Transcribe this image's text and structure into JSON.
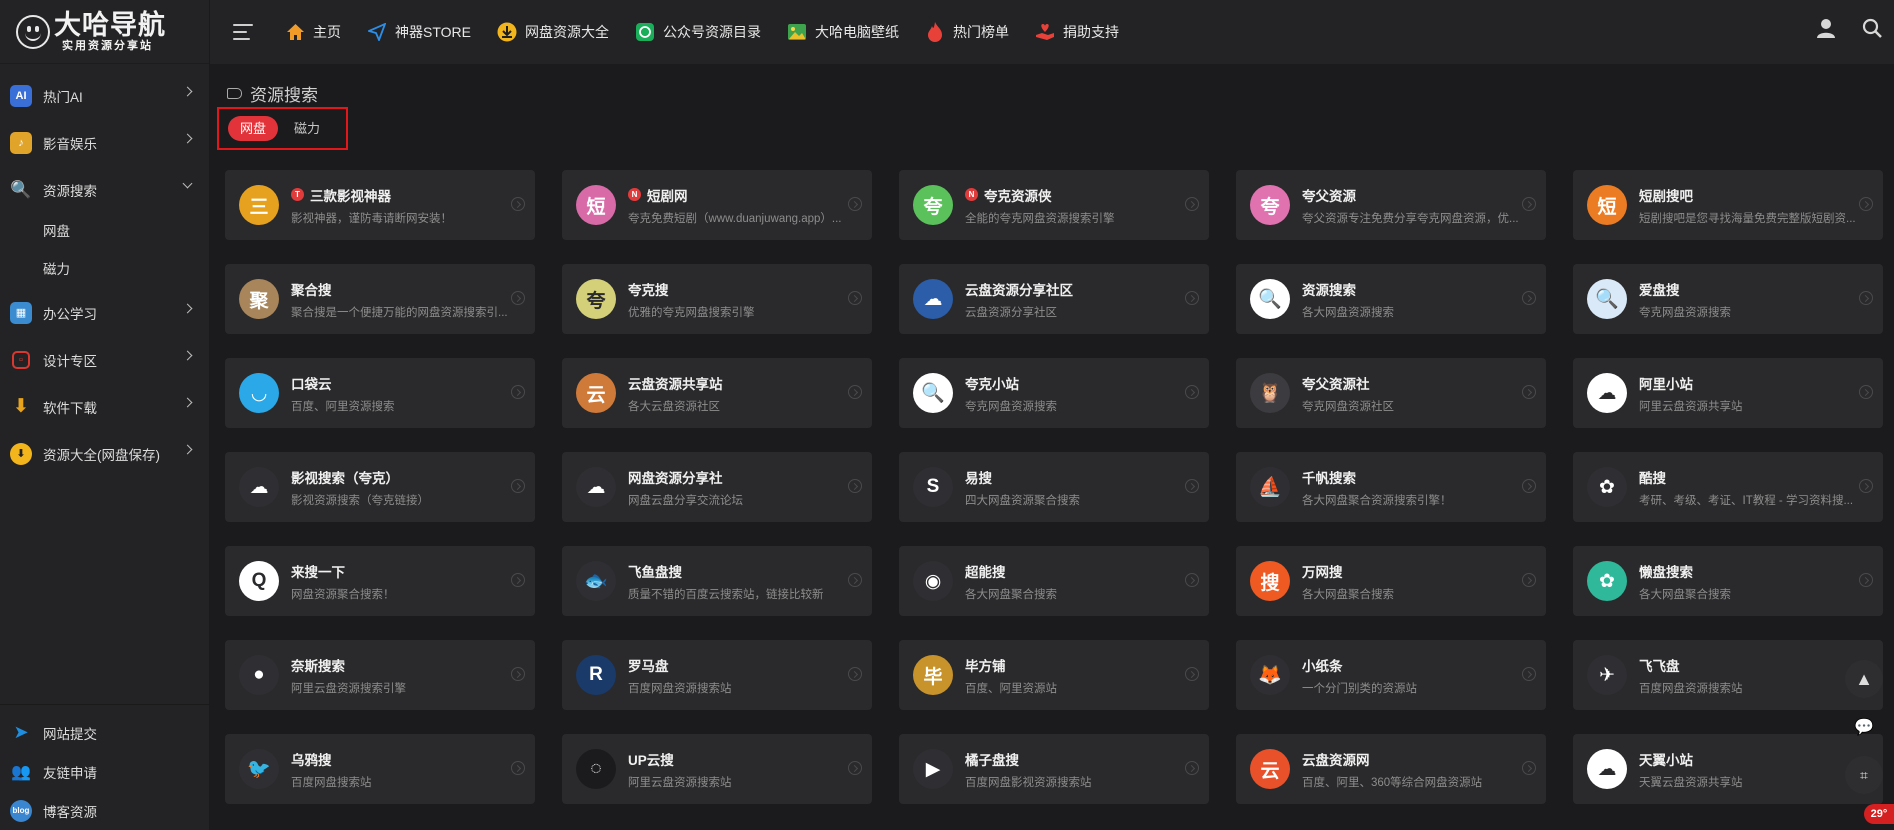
{
  "logo": {
    "title": "大哈导航",
    "subtitle": "实用资源分享站"
  },
  "topnav": [
    {
      "label": "主页",
      "icon": "home-icon"
    },
    {
      "label": "神器STORE",
      "icon": "paper-plane-icon"
    },
    {
      "label": "网盘资源大全",
      "icon": "download-icon"
    },
    {
      "label": "公众号资源目录",
      "icon": "wechat-icon"
    },
    {
      "label": "大哈电脑壁纸",
      "icon": "picture-icon"
    },
    {
      "label": "热门榜单",
      "icon": "fire-icon"
    },
    {
      "label": "捐助支持",
      "icon": "donate-icon"
    }
  ],
  "sidebar": {
    "items": [
      {
        "label": "热门AI",
        "icon": "ai-icon",
        "color": "#3a6fd8"
      },
      {
        "label": "影音娱乐",
        "icon": "media-icon",
        "color": "#e0a42b"
      },
      {
        "label": "资源搜索",
        "icon": "search-icon",
        "color": "#1c9bd6"
      },
      {
        "label": "办公学习",
        "icon": "office-icon",
        "color": "#3a8bd0"
      },
      {
        "label": "设计专区",
        "icon": "calendar-icon",
        "color": "#d8382f"
      },
      {
        "label": "软件下载",
        "icon": "download-icon",
        "color": "#e8a31c"
      },
      {
        "label": "资源大全(网盘保存)",
        "icon": "cloud-download-icon",
        "color": "#f3b51c"
      }
    ],
    "subitems": [
      "网盘",
      "磁力"
    ],
    "bottom": [
      {
        "label": "网站提交",
        "icon": "send-icon",
        "color": "#1e8fe0"
      },
      {
        "label": "友链申请",
        "icon": "users-icon",
        "color": "#3e8fe0"
      },
      {
        "label": "博客资源",
        "icon": "blog-icon",
        "color": "#3a86d0"
      }
    ]
  },
  "section": {
    "title": "资源搜索",
    "tabs": [
      "网盘",
      "磁力"
    ]
  },
  "cards": [
    {
      "name": "三款影视神器",
      "desc": "影视神器，谨防毒请断网安装！",
      "icon": "三",
      "color": "#e6a21f",
      "badge": "T"
    },
    {
      "name": "短剧网",
      "desc": "夸克免费短剧（www.duanjuwang.app）...",
      "icon": "短",
      "color": "#d86aa8",
      "badge": "N"
    },
    {
      "name": "夸克资源侠",
      "desc": "全能的夸克网盘资源搜索引擎",
      "icon": "夸",
      "color": "#5bc25b",
      "badge": "N"
    },
    {
      "name": "夸父资源",
      "desc": "夸父资源专注免费分享夸克网盘资源，优...",
      "icon": "夸",
      "color": "#e072b0"
    },
    {
      "name": "短剧搜吧",
      "desc": "短剧搜吧是您寻找海量免费完整版短剧资...",
      "icon": "短",
      "color": "#ec7c23"
    },
    {
      "name": "聚合搜",
      "desc": "聚合搜是一个便捷万能的网盘资源搜索引...",
      "icon": "聚",
      "color": "#a8855a"
    },
    {
      "name": "夸克搜",
      "desc": "优雅的夸克网盘搜索引擎",
      "icon": "夸",
      "color": "#d4d07a"
    },
    {
      "name": "云盘资源分享社区",
      "desc": "云盘资源分享社区",
      "icon": "☁",
      "color": "#2b5da8"
    },
    {
      "name": "资源搜索",
      "desc": "各大网盘资源搜索",
      "icon": "🔍",
      "color": "#ffffff"
    },
    {
      "name": "爱盘搜",
      "desc": "夸克网盘资源搜索",
      "icon": "🔍",
      "color": "#d9e9f8"
    },
    {
      "name": "口袋云",
      "desc": "百度、阿里资源搜索",
      "icon": "◡",
      "color": "#2aa8e8"
    },
    {
      "name": "云盘资源共享站",
      "desc": "各大云盘资源社区",
      "icon": "云",
      "color": "#d07a3a"
    },
    {
      "name": "夸克小站",
      "desc": "夸克网盘资源搜索",
      "icon": "🔍",
      "color": "#ffffff"
    },
    {
      "name": "夸父资源社",
      "desc": "夸克网盘资源社区",
      "icon": "🦉",
      "color": "#3c3c40"
    },
    {
      "name": "阿里小站",
      "desc": "阿里云盘资源共享站",
      "icon": "☁",
      "color": "#ffffff"
    },
    {
      "name": "影视搜索（夸克）",
      "desc": "影视资源搜索（夸克链接）",
      "icon": "☁",
      "color": "#2f2f33"
    },
    {
      "name": "网盘资源分享社",
      "desc": "网盘云盘分享交流论坛",
      "icon": "☁",
      "color": "#2f2f33"
    },
    {
      "name": "易搜",
      "desc": "四大网盘资源聚合搜索",
      "icon": "S",
      "color": "#2f2f33"
    },
    {
      "name": "千帆搜索",
      "desc": "各大网盘聚合资源搜索引擎！",
      "icon": "⛵",
      "color": "#2f2f33"
    },
    {
      "name": "酷搜",
      "desc": "考研、考级、考证、IT教程 - 学习资料搜...",
      "icon": "✿",
      "color": "#2f2f33"
    },
    {
      "name": "来搜一下",
      "desc": "网盘资源聚合搜索！",
      "icon": "Q",
      "color": "#ffffff"
    },
    {
      "name": "飞鱼盘搜",
      "desc": "质量不错的百度云搜索站，链接比较新",
      "icon": "🐟",
      "color": "#2f2f33"
    },
    {
      "name": "超能搜",
      "desc": "各大网盘聚合搜索",
      "icon": "◉",
      "color": "#2f2f33"
    },
    {
      "name": "万网搜",
      "desc": "各大网盘聚合搜索",
      "icon": "搜",
      "color": "#ee5a22"
    },
    {
      "name": "懒盘搜索",
      "desc": "各大网盘聚合搜索",
      "icon": "✿",
      "color": "#2fb89a"
    },
    {
      "name": "奈斯搜索",
      "desc": "阿里云盘资源搜索引擎",
      "icon": "●",
      "color": "#2f2f33"
    },
    {
      "name": "罗马盘",
      "desc": "百度网盘资源搜索站",
      "icon": "R",
      "color": "#1a3a6a"
    },
    {
      "name": "毕方铺",
      "desc": "百度、阿里资源站",
      "icon": "毕",
      "color": "#c8932a"
    },
    {
      "name": "小纸条",
      "desc": "一个分门别类的资源站",
      "icon": "🦊",
      "color": "#2f2f33"
    },
    {
      "name": "飞飞盘",
      "desc": "百度网盘资源搜索站",
      "icon": "✈",
      "color": "#2f2f33"
    },
    {
      "name": "乌鸦搜",
      "desc": "百度网盘搜索站",
      "icon": "🐦",
      "color": "#2f2f33"
    },
    {
      "name": "UP云搜",
      "desc": "阿里云盘资源搜索站",
      "icon": "◌",
      "color": "#1b1b1d"
    },
    {
      "name": "橘子盘搜",
      "desc": "百度网盘影视资源搜索站",
      "icon": "▶",
      "color": "#2f2f33"
    },
    {
      "name": "云盘资源网",
      "desc": "百度、阿里、360等综合网盘资源站",
      "icon": "云",
      "color": "#e8512a"
    },
    {
      "name": "天翼小站",
      "desc": "天翼云盘资源共享站",
      "icon": "☁",
      "color": "#ffffff"
    }
  ],
  "weather": "29°",
  "colors": {
    "accent": "#e13339",
    "highlight_border": "#e1171b"
  }
}
